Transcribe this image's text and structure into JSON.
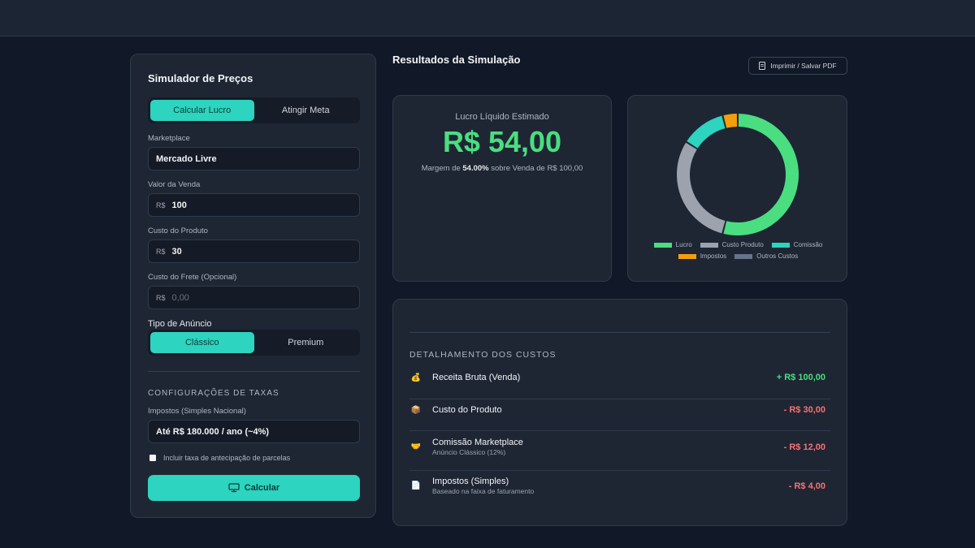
{
  "simulator": {
    "title": "Simulador de Preços",
    "mode_tabs": [
      "Calcular Lucro",
      "Atingir Meta"
    ],
    "marketplace_label": "Marketplace",
    "marketplace_value": "Mercado Livre",
    "sale_value_label": "Valor da Venda",
    "currency_prefix": "R$",
    "sale_value": "100",
    "product_cost_label": "Custo do Produto",
    "product_cost": "30",
    "shipping_cost_label": "Custo do Frete (Opcional)",
    "shipping_placeholder": "0,00",
    "ad_type_label": "Tipo de Anúncio",
    "ad_type_tabs": [
      "Clássico",
      "Premium"
    ],
    "fees_heading": "CONFIGURAÇÕES DE TAXAS",
    "taxes_label": "Impostos (Simples Nacional)",
    "taxes_value": "Até R$ 180.000 / ano (~4%)",
    "installment_checkbox_label": "Incluir taxa de antecipação de parcelas",
    "calculate_button": "Calcular"
  },
  "results": {
    "title": "Resultados da Simulação",
    "print_button": "Imprimir / Salvar PDF",
    "profit_label": "Lucro Líquido Estimado",
    "profit_value": "R$ 54,00",
    "margin_prefix": "Margem de ",
    "margin_value": "54.00%",
    "margin_suffix": " sobre Venda de R$ 100,00"
  },
  "chart_data": {
    "type": "pie",
    "style": "donut",
    "categories": [
      "Lucro",
      "Custo Produto",
      "Comissão",
      "Impostos",
      "Outros Custos"
    ],
    "values": [
      54,
      30,
      12,
      4,
      0
    ],
    "colors": [
      "#4ade80",
      "#9ca3af",
      "#2dd4bf",
      "#f59e0b",
      "#64748b"
    ],
    "legend_position": "bottom"
  },
  "details": {
    "heading": "DETALHAMENTO DOS CUSTOS",
    "rows": [
      {
        "icon": "money-bag-icon",
        "glyph": "💰",
        "name": "Receita Bruta (Venda)",
        "sub": "",
        "amount": "+ R$ 100,00",
        "sign": "pos"
      },
      {
        "icon": "package-icon",
        "glyph": "📦",
        "name": "Custo do Produto",
        "sub": "",
        "amount": "- R$ 30,00",
        "sign": "neg"
      },
      {
        "icon": "handshake-icon",
        "glyph": "🤝",
        "name": "Comissão Marketplace",
        "sub": "Anúncio Clássico (12%)",
        "amount": "- R$ 12,00",
        "sign": "neg"
      },
      {
        "icon": "document-icon",
        "glyph": "📄",
        "name": "Impostos (Simples)",
        "sub": "Baseado na faixa de faturamento",
        "amount": "- R$ 4,00",
        "sign": "neg"
      }
    ]
  }
}
